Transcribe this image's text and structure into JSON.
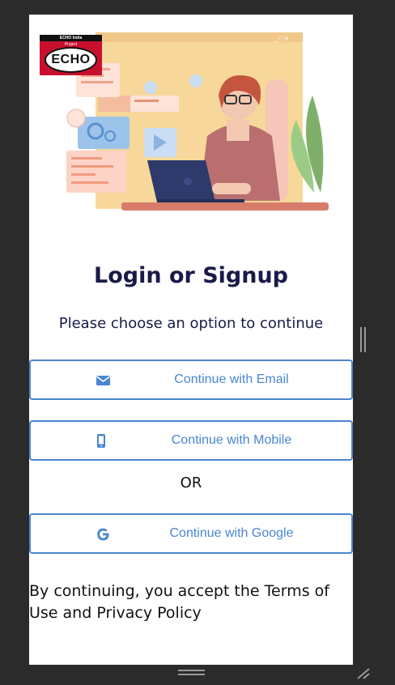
{
  "brand": {
    "logo_top": "ECHO India",
    "logo_sub": "Project",
    "logo_text": "ECHO"
  },
  "login": {
    "title": "Login or Signup",
    "subtitle": "Please choose an option to continue",
    "or_label": "OR",
    "terms": "By continuing, you accept the Terms of Use and Privacy Policy"
  },
  "buttons": {
    "email": {
      "label": "Continue with Email",
      "icon": "envelope-icon"
    },
    "mobile": {
      "label": "Continue with Mobile",
      "icon": "mobile-phone-icon"
    },
    "google": {
      "label": "Continue with Google",
      "icon": "google-icon"
    }
  },
  "colors": {
    "accent": "#4a86d0",
    "title": "#1a1a4a",
    "background": "#2b2b2b"
  }
}
